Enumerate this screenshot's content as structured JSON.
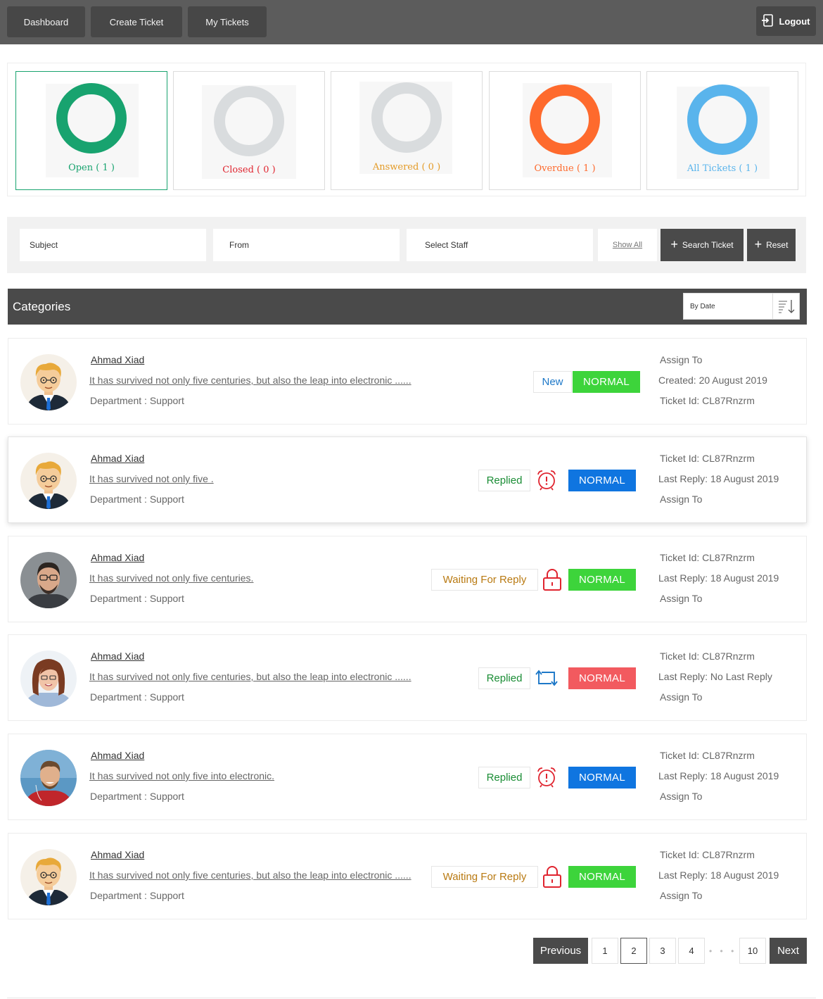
{
  "nav": {
    "dashboard": "Dashboard",
    "create_ticket": "Create Ticket",
    "my_tickets": "My Tickets",
    "logout": "Logout"
  },
  "stats": [
    {
      "label": "Open ( 1 )",
      "color": "#18a36f",
      "active": true
    },
    {
      "label": "Closed ( 0 )",
      "color": "#d9dcde",
      "label_color": "#e0242f"
    },
    {
      "label": "Answered ( 0 )",
      "color": "#d9dcde",
      "label_color": "#e49b27"
    },
    {
      "label": "Overdue ( 1 )",
      "color": "#fe6a2d",
      "label_color": "#fe6a2d"
    },
    {
      "label": "All Tickets ( 1 )",
      "color": "#59b4ec",
      "label_color": "#59b4ec"
    }
  ],
  "filters": {
    "subject_placeholder": "Subject",
    "from_placeholder": "From",
    "staff_placeholder": "Select Staff",
    "show_all": "Show All",
    "search_button": "Search Ticket",
    "reset_button": "Reset"
  },
  "categories": {
    "title": "Categories",
    "sort_value": "By Date"
  },
  "tickets": [
    {
      "name": "Ahmad Xiad",
      "subject": "It has survived not only five centuries, but also the leap into electronic ......",
      "department": "Department : Support",
      "status": "New",
      "status_color": "#1d78c8",
      "state_icon": "",
      "priority": "NORMAL",
      "priority_color": "#3dd43b",
      "right1": "Assign To",
      "right2": "Created: 20 August 2019",
      "right3": "Ticket Id: CL87Rnzrm",
      "avatar": "cartoon-man-avatar"
    },
    {
      "name": "Ahmad Xiad",
      "subject": "It has survived not only five .",
      "department": "Department : Support",
      "status": "Replied",
      "status_color": "#1a8d35",
      "state_icon": "alarm-clock-icon",
      "priority": "NORMAL",
      "priority_color": "#0f75e0",
      "right1": "Ticket Id: CL87Rnzrm",
      "right2": "Last Reply: 18 August 2019",
      "right3": "Assign To",
      "avatar": "cartoon-man-avatar"
    },
    {
      "name": "Ahmad Xiad",
      "subject": "It has survived not only five centuries.",
      "department": "Department : Support",
      "status": "Waiting For Reply",
      "status_color": "#b97a12",
      "state_icon": "lock-icon",
      "priority": "NORMAL",
      "priority_color": "#3dd43b",
      "right1": "Ticket Id: CL87Rnzrm",
      "right2": "Last Reply: 18 August 2019",
      "right3": "Assign To",
      "avatar": "man-with-glasses-photo"
    },
    {
      "name": "Ahmad Xiad",
      "subject": "It has survived not only five centuries, but also the leap into electronic ......",
      "department": "Department : Support",
      "status": "Replied",
      "status_color": "#1a8d35",
      "state_icon": "repeat-icon",
      "priority": "NORMAL",
      "priority_color": "#f25a5f",
      "right1": "Ticket Id: CL87Rnzrm",
      "right2": "Last Reply: No Last Reply",
      "right3": "Assign To",
      "avatar": "woman-photo"
    },
    {
      "name": "Ahmad Xiad",
      "subject": "It has survived not only five into electronic.",
      "department": "Department : Support",
      "status": "Replied",
      "status_color": "#1a8d35",
      "state_icon": "alarm-clock-icon",
      "priority": "NORMAL",
      "priority_color": "#0f75e0",
      "right1": "Ticket Id: CL87Rnzrm",
      "right2": "Last Reply: 18 August 2019",
      "right3": "Assign To",
      "avatar": "man-red-shirt-photo"
    },
    {
      "name": "Ahmad Xiad",
      "subject": "It has survived not only five centuries, but also the leap into electronic ......",
      "department": "Department : Support",
      "status": "Waiting For Reply",
      "status_color": "#b97a12",
      "state_icon": "lock-icon",
      "priority": "NORMAL",
      "priority_color": "#3dd43b",
      "right1": "Ticket Id: CL87Rnzrm",
      "right2": "Last Reply: 18 August 2019",
      "right3": "Assign To",
      "avatar": "cartoon-man-avatar"
    }
  ],
  "pagination": {
    "previous": "Previous",
    "pages": [
      "1",
      "2",
      "3",
      "4"
    ],
    "dots": "• • • • •",
    "last": "10",
    "next": "Next",
    "current": "2"
  }
}
